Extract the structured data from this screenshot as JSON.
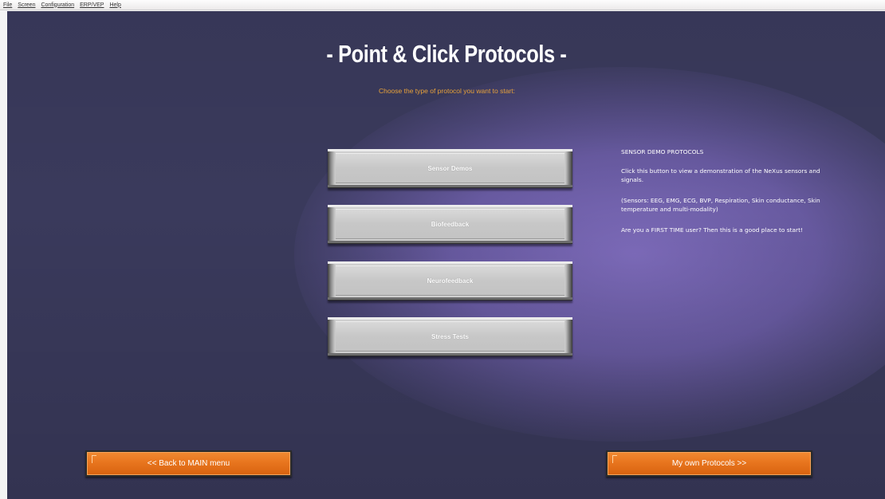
{
  "menu": {
    "items": [
      "File",
      "Screen",
      "Configuration",
      "ERP/VEP",
      "Help"
    ]
  },
  "page": {
    "title": "- Point & Click Protocols -",
    "subtitle": "Choose the type of protocol you want to start:"
  },
  "protocol_buttons": [
    "Sensor Demos",
    "Biofeedback",
    "Neurofeedback",
    "Stress Tests"
  ],
  "description": {
    "heading": "SENSOR DEMO PROTOCOLS",
    "paragraphs": [
      "Click this button to view a demonstration of the NeXus sensors and signals.",
      "(Sensors: EEG, EMG, ECG, BVP, Respiration, Skin conductance, Skin temperature and multi-modality)",
      "Are you a FIRST TIME user? Then this is a good place to start!"
    ]
  },
  "nav": {
    "back_label": "<< Back to MAIN menu",
    "own_label": "My own Protocols >>"
  },
  "colors": {
    "background": "#3a3a5c",
    "spotlight": "#8470c4",
    "subtitle": "#e8a23a",
    "orange_button": "#e8751e"
  }
}
